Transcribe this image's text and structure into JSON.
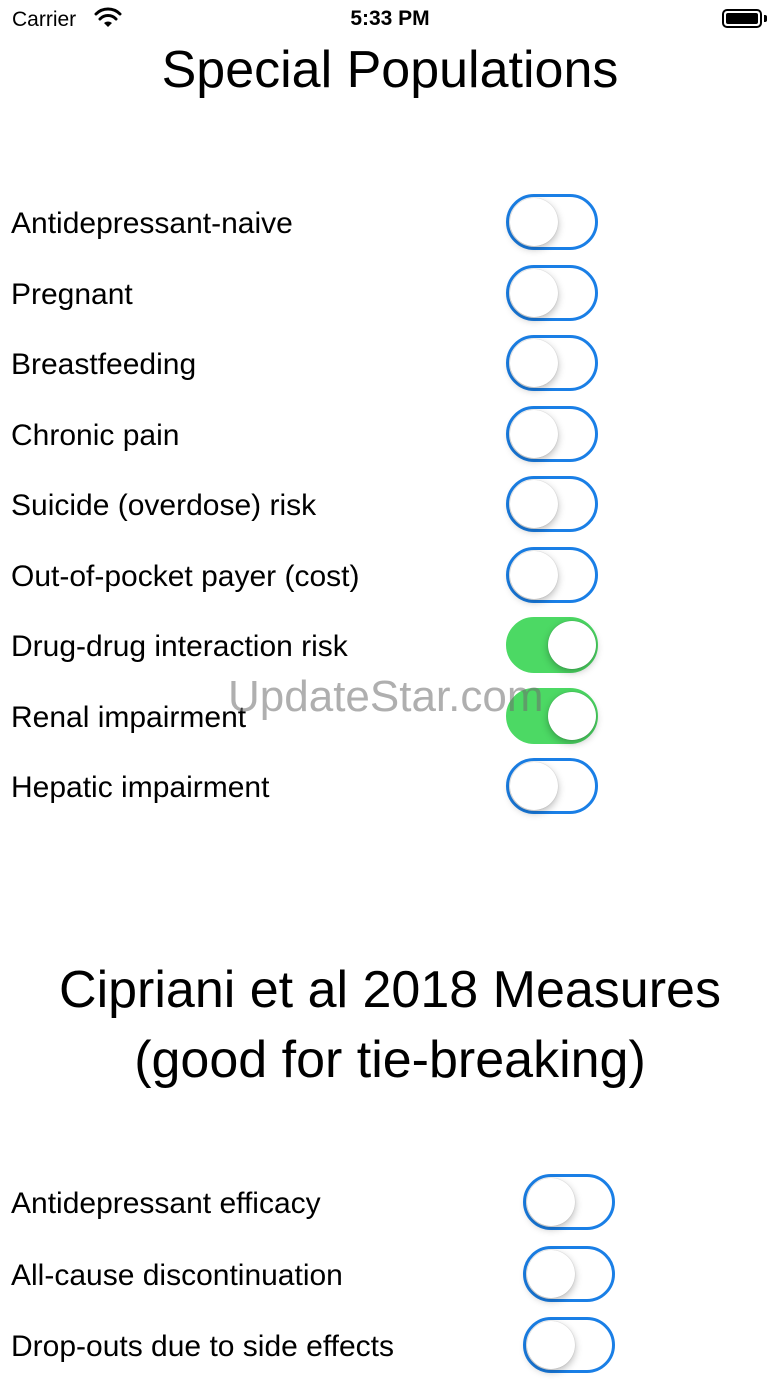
{
  "status_bar": {
    "carrier": "Carrier",
    "time": "5:33 PM",
    "icons": [
      "wifi-icon",
      "battery-icon"
    ]
  },
  "section1": {
    "title": "Special Populations",
    "items": [
      {
        "label": "Antidepressant-naive",
        "on": false
      },
      {
        "label": "Pregnant",
        "on": false
      },
      {
        "label": "Breastfeeding",
        "on": false
      },
      {
        "label": "Chronic pain",
        "on": false
      },
      {
        "label": "Suicide (overdose) risk",
        "on": false
      },
      {
        "label": "Out-of-pocket payer (cost)",
        "on": false
      },
      {
        "label": "Drug-drug interaction risk",
        "on": true
      },
      {
        "label": "Renal impairment",
        "on": true
      },
      {
        "label": "Hepatic impairment",
        "on": false
      }
    ]
  },
  "section2": {
    "title_line1": "Cipriani et al 2018 Measures",
    "title_line2": "(good for tie-breaking)",
    "items": [
      {
        "label": "Antidepressant efficacy",
        "on": false
      },
      {
        "label": "All-cause discontinuation",
        "on": false
      },
      {
        "label": "Drop-outs due to side effects",
        "on": false
      }
    ]
  },
  "watermark": "UpdateStar.com",
  "colors": {
    "switch_off_border": "#1a7fe6",
    "switch_on": "#4cd964",
    "background": "#ffffff"
  }
}
